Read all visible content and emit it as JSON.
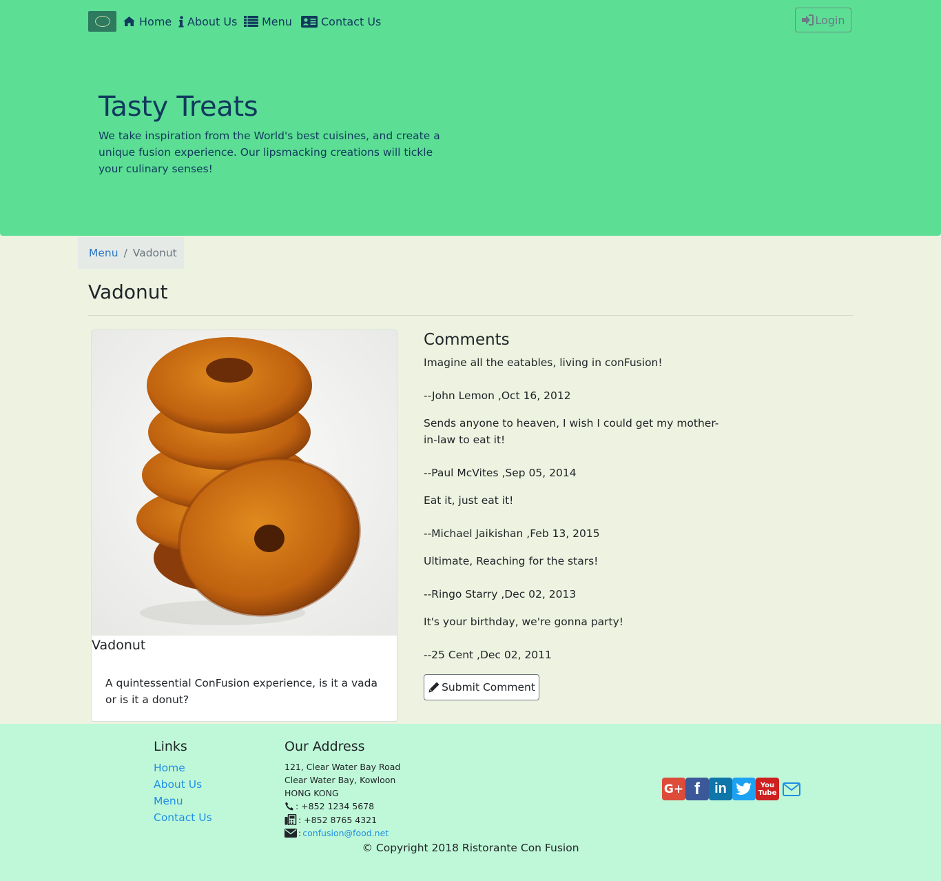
{
  "nav": {
    "home": "Home",
    "about": "About Us",
    "menu": "Menu",
    "contact": "Contact Us",
    "login": "Login"
  },
  "jumbotron": {
    "title": "Tasty Treats",
    "text": "We take inspiration from the World's best cuisines, and create a unique fusion experience. Our lipsmacking creations will tickle your culinary senses!"
  },
  "breadcrumb": {
    "parent": "Menu",
    "separator": "/",
    "current": "Vadonut"
  },
  "dish": {
    "heading": "Vadonut",
    "card_title": "Vadonut",
    "description": "A quintessential ConFusion experience, is it a vada or is it a donut?"
  },
  "comments": {
    "heading": "Comments",
    "items": [
      {
        "text": "Imagine all the eatables, living in conFusion!",
        "author": "--John Lemon ,Oct 16, 2012"
      },
      {
        "text": "Sends anyone to heaven, I wish I could get my mother-in-law to eat it!",
        "author": "--Paul McVites ,Sep 05, 2014"
      },
      {
        "text": "Eat it, just eat it!",
        "author": "--Michael Jaikishan ,Feb 13, 2015"
      },
      {
        "text": "Ultimate, Reaching for the stars!",
        "author": "--Ringo Starry ,Dec 02, 2013"
      },
      {
        "text": "It's your birthday, we're gonna party!",
        "author": "--25 Cent ,Dec 02, 2011"
      }
    ],
    "submit_label": "Submit Comment"
  },
  "footer": {
    "links_heading": "Links",
    "links": [
      "Home",
      "About Us",
      "Menu",
      "Contact Us"
    ],
    "address_heading": "Our Address",
    "address_lines": [
      "121, Clear Water Bay Road",
      "Clear Water Bay, Kowloon",
      "HONG KONG"
    ],
    "phone": ": +852 1234 5678",
    "fax": ": +852 8765 4321",
    "email_prefix": ":",
    "email": "confusion@food.net",
    "copyright": "© Copyright 2018 Ristorante Con Fusion"
  },
  "social": {
    "google": "G+",
    "facebook": "f",
    "linkedin": "in",
    "youtube_top": "You",
    "youtube_bottom": "Tube"
  },
  "colors": {
    "navbar": "#5cde95",
    "body_bg": "#edf3e0",
    "footer_bg": "#bff8d8",
    "heading_navy": "#103a5c",
    "link_blue": "#1f8fe6"
  }
}
